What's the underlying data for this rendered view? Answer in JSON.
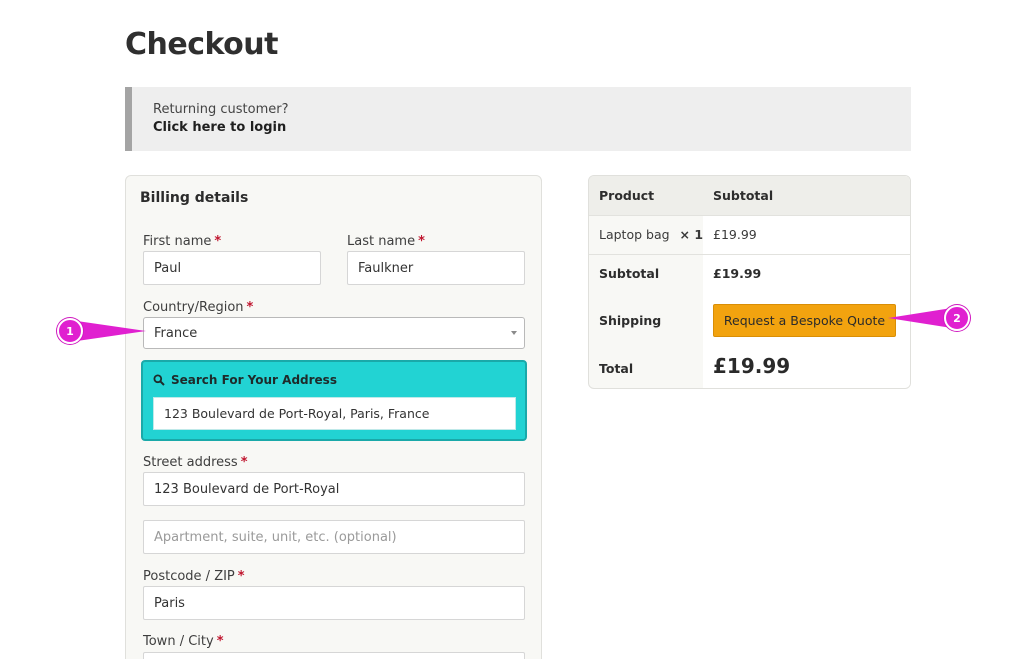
{
  "page": {
    "title": "Checkout"
  },
  "login_notice": {
    "question": "Returning customer?",
    "link": "Click here to login"
  },
  "billing": {
    "title": "Billing details",
    "first_name": {
      "label": "First name",
      "value": "Paul"
    },
    "last_name": {
      "label": "Last name",
      "value": "Faulkner"
    },
    "country": {
      "label": "Country/Region",
      "value": "France"
    },
    "address_search": {
      "title": "Search For Your Address",
      "value": "123 Boulevard de Port-Royal, Paris, France"
    },
    "street": {
      "label": "Street address",
      "value": "123 Boulevard de Port-Royal"
    },
    "apartment": {
      "placeholder": "Apartment, suite, unit, etc. (optional)"
    },
    "postcode": {
      "label": "Postcode / ZIP",
      "value": "Paris"
    },
    "town": {
      "label": "Town / City",
      "value": ""
    },
    "required_mark": "*"
  },
  "order": {
    "headers": {
      "product": "Product",
      "subtotal": "Subtotal"
    },
    "item": {
      "name": "Laptop bag",
      "qty": "× 1",
      "price": "£19.99"
    },
    "subtotal": {
      "label": "Subtotal",
      "value": "£19.99"
    },
    "shipping": {
      "label": "Shipping",
      "button": "Request a Bespoke Quote"
    },
    "total": {
      "label": "Total",
      "value": "£19.99"
    }
  },
  "annotations": {
    "marker_1": "1",
    "marker_2": "2"
  },
  "colors": {
    "accent_teal": "#22d3d3",
    "quote_button": "#f2a30f",
    "marker": "#e020d0",
    "required": "#c0162f"
  }
}
